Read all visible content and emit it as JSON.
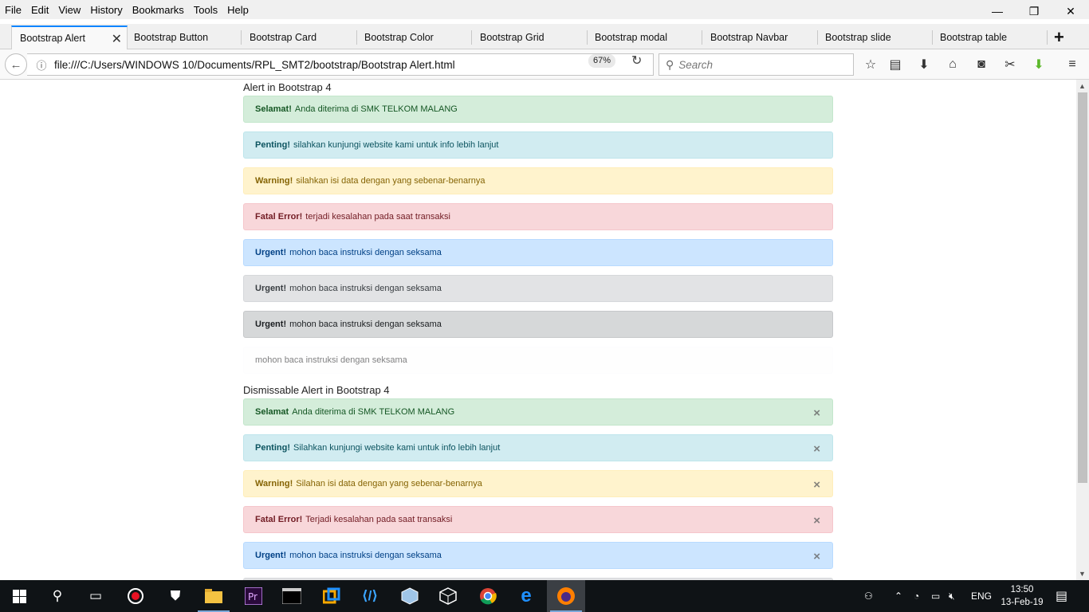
{
  "menubar": {
    "items": [
      "File",
      "Edit",
      "View",
      "History",
      "Bookmarks",
      "Tools",
      "Help"
    ]
  },
  "window_controls": {
    "minimize": "—",
    "restore": "❐",
    "close": "✕"
  },
  "tabs": [
    {
      "label": "Bootstrap Alert",
      "active": true
    },
    {
      "label": "Bootstrap Button"
    },
    {
      "label": "Bootstrap Card"
    },
    {
      "label": "Bootstrap Color"
    },
    {
      "label": "Bootstrap Grid"
    },
    {
      "label": "Bootstrap modal"
    },
    {
      "label": "Bootstrap Navbar"
    },
    {
      "label": "Bootstrap slide"
    },
    {
      "label": "Bootstrap table"
    }
  ],
  "navbar": {
    "url": "file:///C:/Users/WINDOWS 10/Documents/RPL_SMT2/bootstrap/Bootstrap Alert.html",
    "zoom": "67%",
    "search_placeholder": "Search"
  },
  "page": {
    "section1_title": "Alert in Bootstrap 4",
    "alerts": [
      {
        "variant": "success",
        "strong": "Selamat!",
        "text": "Anda diterima di SMK TELKOM MALANG"
      },
      {
        "variant": "info",
        "strong": "Penting!",
        "text": "silahkan kunjungi website kami untuk info lebih lanjut"
      },
      {
        "variant": "warning",
        "strong": "Warning!",
        "text": "silahkan isi data dengan yang sebenar-benarnya"
      },
      {
        "variant": "danger",
        "strong": "Fatal Error!",
        "text": "terjadi kesalahan pada saat transaksi"
      },
      {
        "variant": "primary",
        "strong": "Urgent!",
        "text": "mohon baca instruksi dengan seksama"
      },
      {
        "variant": "secondary",
        "strong": "Urgent!",
        "text": "mohon baca instruksi dengan seksama"
      },
      {
        "variant": "dark",
        "strong": "Urgent!",
        "text": "mohon baca instruksi dengan seksama"
      },
      {
        "variant": "light",
        "strong": "",
        "text": "mohon baca instruksi dengan seksama"
      }
    ],
    "section2_title": "Dismissable Alert in Bootstrap 4",
    "dismissable_alerts": [
      {
        "variant": "success",
        "strong": "Selamat",
        "text": "Anda diterima di SMK TELKOM MALANG",
        "close": "×"
      },
      {
        "variant": "info",
        "strong": "Penting!",
        "text": "Silahkan kunjungi website kami untuk info lebih lanjut",
        "close": "×"
      },
      {
        "variant": "warning",
        "strong": "Warning!",
        "text": "Silahan isi data dengan yang sebenar-benarnya",
        "close": "×"
      },
      {
        "variant": "danger",
        "strong": "Fatal Error!",
        "text": "Terjadi kesalahan pada saat transaksi",
        "close": "×"
      },
      {
        "variant": "primary",
        "strong": "Urgent!",
        "text": "mohon baca instruksi dengan seksama",
        "close": "×"
      }
    ]
  },
  "taskbar": {
    "language": "ENG",
    "time": "13:50",
    "date": "13-Feb-19"
  },
  "colors": {
    "success_bg": "#d4edda",
    "info_bg": "#d1ecf1",
    "warning_bg": "#fff3cd",
    "danger_bg": "#f8d7da",
    "primary_bg": "#cce5ff",
    "secondary_bg": "#e2e3e5",
    "dark_bg": "#d6d8d9",
    "light_bg": "#fefefe",
    "tab_accent": "#0a84ff"
  }
}
